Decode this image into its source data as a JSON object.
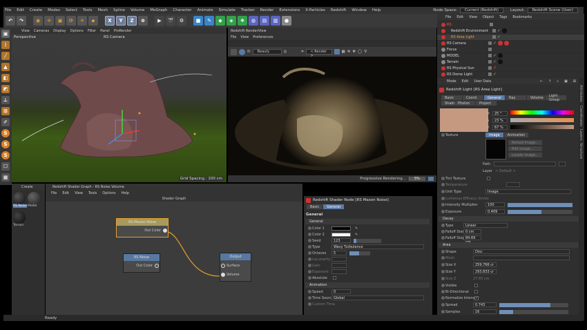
{
  "menu": {
    "items": [
      "File",
      "Edit",
      "Create",
      "Modes",
      "Select",
      "Tools",
      "Mesh",
      "Spline",
      "Volume",
      "MoGraph",
      "Character",
      "Animate",
      "Simulate",
      "Tracker",
      "Render",
      "Extensions",
      "X-Particles",
      "Redshift",
      "Window",
      "Help"
    ],
    "node_space_label": "Node Space:",
    "node_space_value": "Current (Redshift)",
    "layout_label": "Layout:",
    "layout_value": "Redshift Scene (User)"
  },
  "toolbar": {
    "x_label": "X",
    "y_label": "Y",
    "z_label": "Z"
  },
  "viewport": {
    "menu": [
      "View",
      "Cameras",
      "Display",
      "Options",
      "Filter",
      "Panel",
      "ProRender"
    ],
    "view_name": "Perspective",
    "camera": "RS Camera",
    "grid_spacing": "Grid Spacing : 100 cm"
  },
  "renderview": {
    "title": "Redshift RenderView",
    "menu": [
      "File",
      "View",
      "Preferences"
    ],
    "aov": "Beauty",
    "render_target": "< Render >",
    "status": "Progressive Rendering...",
    "progress": "5%",
    "progress_fraction": 0.05
  },
  "objects": {
    "menu": [
      "File",
      "Edit",
      "View",
      "Object",
      "Tags",
      "Bookmarks"
    ],
    "items": [
      "RS",
      "Redshift Environment",
      "RS Area Light",
      "RS Camera",
      "Focus",
      "MODEL",
      "Terrain",
      "RS Physical Sun",
      "RS Dome Light"
    ]
  },
  "attributes": {
    "menu": [
      "Mode",
      "Edit",
      "User Data"
    ],
    "title": "Redshift Light [RS Area Light]",
    "tabs": [
      "Basic",
      "Coord.",
      "General",
      "Ray",
      "Volume",
      "Light Group",
      "Shadow",
      "Photon",
      "Project"
    ],
    "active_tab": "General",
    "color": {
      "h_label": "H",
      "h": "25 °",
      "s_label": "S",
      "s": "23 %",
      "v_label": "V",
      "v": "67 %"
    },
    "texture_label": "Texture",
    "image_tabs": [
      "Image",
      "Animation"
    ],
    "image_buttons": [
      "Reload image...",
      "Edit image...",
      "Locate image..."
    ],
    "path_label": "Path",
    "layer_label": "Layer",
    "layer_value": "< Default >",
    "tint_label": "Tint Texture",
    "temperature_label": "Temperature",
    "unit_type_label": "Unit Type",
    "unit_type_value": "Image",
    "luminous_label": "Luminous Efficacy (lm/w)",
    "intensity_label": "Intensity Multiplier",
    "intensity_value": "100",
    "exposure_label": "Exposure",
    "exposure_value": "0.409",
    "decay_title": "Decay",
    "decay_type_label": "Type",
    "decay_type_value": "Linear",
    "falloff_start_label": "Falloff Start",
    "falloff_start_value": "0 cm",
    "falloff_stop_label": "Falloff Stop",
    "falloff_stop_value": "84.69 cm",
    "area_title": "Area",
    "shape_label": "Shape",
    "shape_value": "Disc",
    "mesh_label": "Mesh",
    "size_x_label": "Size X",
    "size_x_value": "259.766 cr",
    "size_y_label": "Size Y",
    "size_y_value": "293.833 cr",
    "size_z_label": "Size Z",
    "size_z_value": "27.65 cm",
    "visible_label": "Visible",
    "bidir_label": "Bi-Directional",
    "normalize_label": "Normalize Intensity",
    "spread_label": "Spread",
    "spread_value": "0.743",
    "samples_label": "Samples",
    "samples_value": "16"
  },
  "right_tabs": [
    "Attributes",
    "Coordinates",
    "Layers",
    "Structure"
  ],
  "materials": {
    "menu": [
      "Create"
    ],
    "items": [
      "RS Noise",
      "Model",
      "Terrain"
    ]
  },
  "shader_graph": {
    "title": "Redshift Shader Graph - RS Noise Volume",
    "menu": [
      "File",
      "Edit",
      "View",
      "Tools",
      "Options",
      "Help"
    ],
    "canvas_title": "Shader Graph",
    "nodes": {
      "maxon": {
        "title": "RS Maxon Noise",
        "port": "Out Color"
      },
      "noise": {
        "title": "RS Noise",
        "port": "Out Color"
      },
      "output": {
        "title": "Output",
        "ports": [
          "Surface",
          "Volume"
        ]
      }
    }
  },
  "node_attr": {
    "title": "Redshift Shader Node [RS Maxon Noise]",
    "tabs": [
      "Basic",
      "General"
    ],
    "section": "General",
    "general_title": "General",
    "color1_label": "Color 1",
    "color2_label": "Color 2",
    "seed_label": "Seed",
    "seed_value": "123",
    "type_label": "Type",
    "type_value": "Wavy Turbulence",
    "octaves_label": "Octaves",
    "octaves_value": "5",
    "lacunarity_label": "Lacunarity",
    "gain_label": "Gain",
    "exponent_label": "Exponent",
    "absolute_label": "Absolute",
    "animation_title": "Animation",
    "speed_label": "Speed",
    "speed_value": "0",
    "time_source_label": "Time Source",
    "time_source_value": "Global",
    "custom_time_label": "Custom Time"
  },
  "status": {
    "text": "Ready"
  }
}
